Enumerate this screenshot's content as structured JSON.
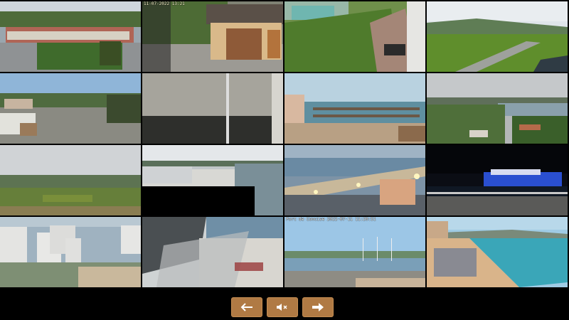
{
  "window": {
    "title": ""
  },
  "grid": {
    "cameras": [
      {
        "id": 1,
        "stamp": "",
        "stamp_bottom": ""
      },
      {
        "id": 2,
        "stamp": "11-07-2022 13:21",
        "stamp_bottom": ""
      },
      {
        "id": 3,
        "stamp": "",
        "stamp_bottom": ""
      },
      {
        "id": 4,
        "stamp": "",
        "stamp_bottom": ""
      },
      {
        "id": 5,
        "stamp": "",
        "stamp_bottom": ""
      },
      {
        "id": 6,
        "stamp": "",
        "stamp_bottom": ""
      },
      {
        "id": 7,
        "stamp": "",
        "stamp_bottom": ""
      },
      {
        "id": 8,
        "stamp": "",
        "stamp_bottom": ""
      },
      {
        "id": 9,
        "stamp": "",
        "stamp_bottom": ""
      },
      {
        "id": 10,
        "stamp": "",
        "stamp_bottom": ""
      },
      {
        "id": 11,
        "stamp": "",
        "stamp_bottom": ""
      },
      {
        "id": 12,
        "stamp": "",
        "stamp_bottom": ""
      },
      {
        "id": 13,
        "stamp": "",
        "stamp_bottom": ""
      },
      {
        "id": 14,
        "stamp": "",
        "stamp_bottom": ""
      },
      {
        "id": 15,
        "stamp": "Port de Concise 2022-07-11 11:20:51",
        "stamp_bottom": ""
      },
      {
        "id": 16,
        "stamp": "",
        "stamp_bottom": ""
      }
    ]
  },
  "controls": {
    "prev_icon": "arrow-left-icon",
    "mute_icon": "speaker-muted-icon",
    "next_icon": "arrow-right-icon",
    "button_color": "#b07a44",
    "icon_color": "#ffffff"
  }
}
